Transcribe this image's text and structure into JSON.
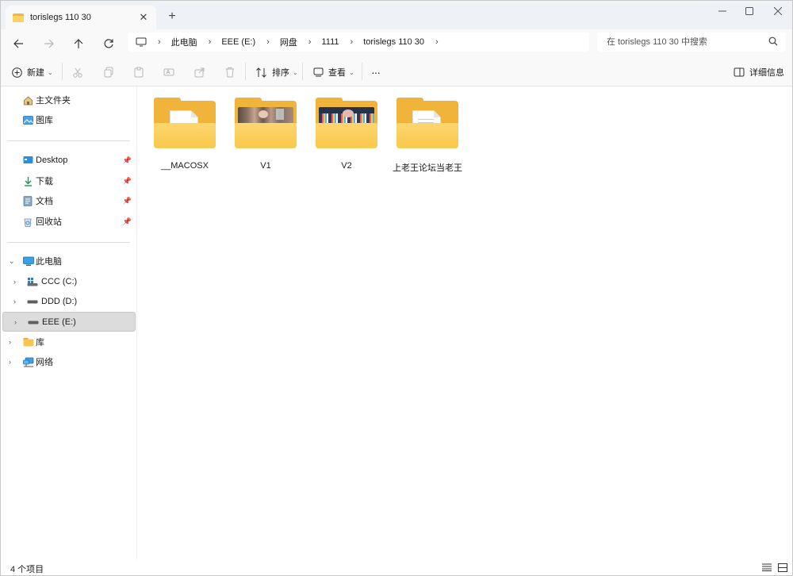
{
  "window": {
    "tab_title": "torislegs 110 30",
    "tab_close_glyph": "✕",
    "new_tab_glyph": "+"
  },
  "nav": {
    "breadcrumb": [
      "此电脑",
      "EEE (E:)",
      "网盘",
      "1111",
      "torislegs 110 30"
    ],
    "search_placeholder": "在 torislegs 110 30 中搜索"
  },
  "toolbar": {
    "new_label": "新建",
    "sort_label": "排序",
    "view_label": "查看",
    "more_label": "···",
    "details_label": "详细信息"
  },
  "sidebar": {
    "quick": [
      {
        "label": "主文件夹",
        "icon": "home-icon"
      },
      {
        "label": "图库",
        "icon": "gallery-icon"
      }
    ],
    "pinned": [
      {
        "label": "Desktop",
        "icon": "desktop-icon"
      },
      {
        "label": "下载",
        "icon": "download-icon"
      },
      {
        "label": "文档",
        "icon": "document-icon"
      },
      {
        "label": "回收站",
        "icon": "recycle-bin-icon"
      }
    ],
    "tree": [
      {
        "label": "此电脑",
        "icon": "computer-icon"
      },
      {
        "label": "CCC (C:)",
        "icon": "system-drive-icon"
      },
      {
        "label": "DDD (D:)",
        "icon": "drive-icon"
      },
      {
        "label": "EEE (E:)",
        "icon": "drive-icon"
      },
      {
        "label": "库",
        "icon": "library-icon"
      },
      {
        "label": "网络",
        "icon": "network-icon"
      }
    ]
  },
  "content": {
    "items": [
      {
        "name": "__MACOSX",
        "type": "folder-document"
      },
      {
        "name": "V1",
        "type": "folder-preview"
      },
      {
        "name": "V2",
        "type": "folder-preview"
      },
      {
        "name": "上老王论坛当老王",
        "type": "folder-document"
      }
    ]
  },
  "status": {
    "count_text": "4 个项目"
  },
  "colors": {
    "folder_back": "#f0b43a",
    "folder_front": "#fcd66e",
    "accent": "#0067c0"
  }
}
